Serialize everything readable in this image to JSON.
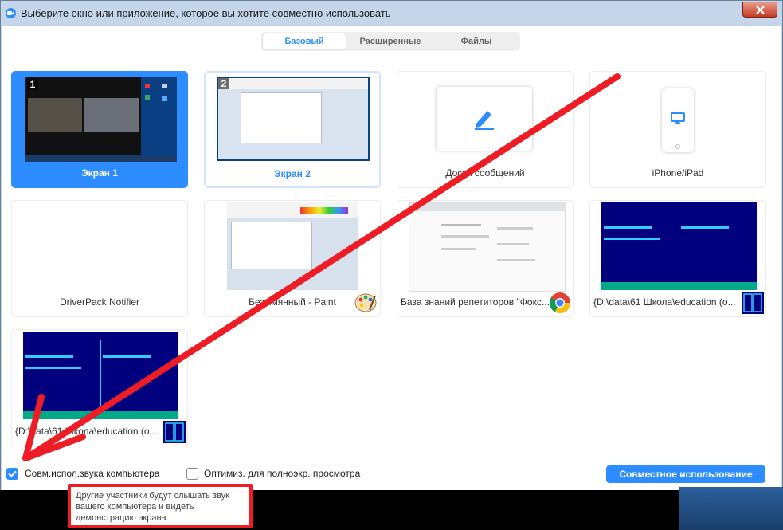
{
  "window": {
    "title": "Выберите окно или приложение, которое вы хотите совместно использовать",
    "icon": "zoom-icon",
    "close_icon": "close-icon"
  },
  "tabs": [
    {
      "label": "Базовый",
      "active": true
    },
    {
      "label": "Расширенные",
      "active": false
    },
    {
      "label": "Файлы",
      "active": false
    }
  ],
  "tiles": [
    {
      "label": "Экран 1",
      "badge": "1",
      "selected": true
    },
    {
      "label": "Экран 2",
      "badge": "2",
      "selected": false
    },
    {
      "label": "Доска сообщений",
      "icon": "pencil-icon"
    },
    {
      "label": "iPhone/iPad",
      "icon": "airplay-icon"
    },
    {
      "label": "DriverPack Notifier"
    },
    {
      "label": "Безымянный - Paint",
      "icon": "paint-palette-icon"
    },
    {
      "label": "База знаний репетиторов \"Фокс...",
      "icon": "chrome-icon"
    },
    {
      "label": "{D:\\data\\61 Школа\\education (о...",
      "icon": "far-manager-icon"
    },
    {
      "label": "{D:\\data\\61 Школа\\education (о...",
      "icon": "far-manager-icon"
    }
  ],
  "bottom": {
    "share_audio_label": "Совм.испол.звука компьютера",
    "share_audio_checked": true,
    "optimize_label": "Оптимиз. для полноэкр. просмотра",
    "optimize_checked": false,
    "share_button": "Совместное использование"
  },
  "tooltip": {
    "text": "Другие участники будут слышать звук вашего компьютера и видеть демонстрацию экрана."
  },
  "colors": {
    "accent": "#2d8cff",
    "annotation_red": "#ee1c24"
  }
}
